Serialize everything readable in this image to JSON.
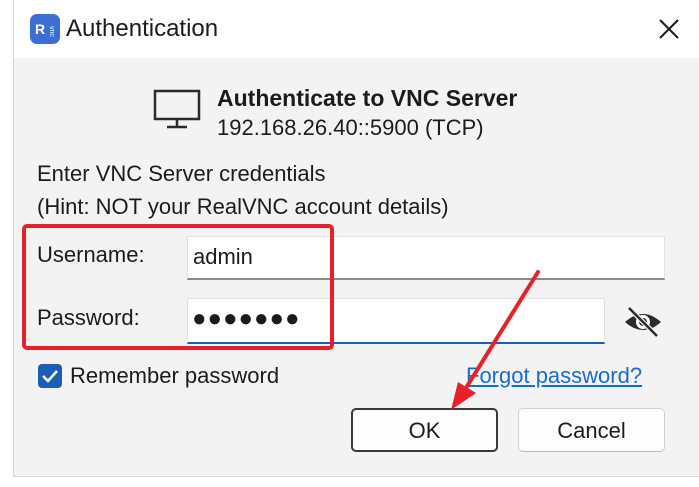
{
  "window": {
    "title": "Authentication",
    "app_icon_glyph": "V",
    "accent_color": "#1a5fb4"
  },
  "server": {
    "heading": "Authenticate to VNC Server",
    "address": "192.168.26.40::5900 (TCP)"
  },
  "prompt": {
    "line1": "Enter VNC Server credentials",
    "line2": "(Hint: NOT your RealVNC account details)"
  },
  "form": {
    "username_label": "Username:",
    "username_value": "admin",
    "password_label": "Password:",
    "password_value": "●●●●●●●",
    "remember_label": "Remember password",
    "remember_checked": true,
    "forgot_link": "Forgot password?"
  },
  "buttons": {
    "ok_label": "OK",
    "cancel_label": "Cancel"
  },
  "annotations": {
    "highlight_color": "#e8202a"
  }
}
